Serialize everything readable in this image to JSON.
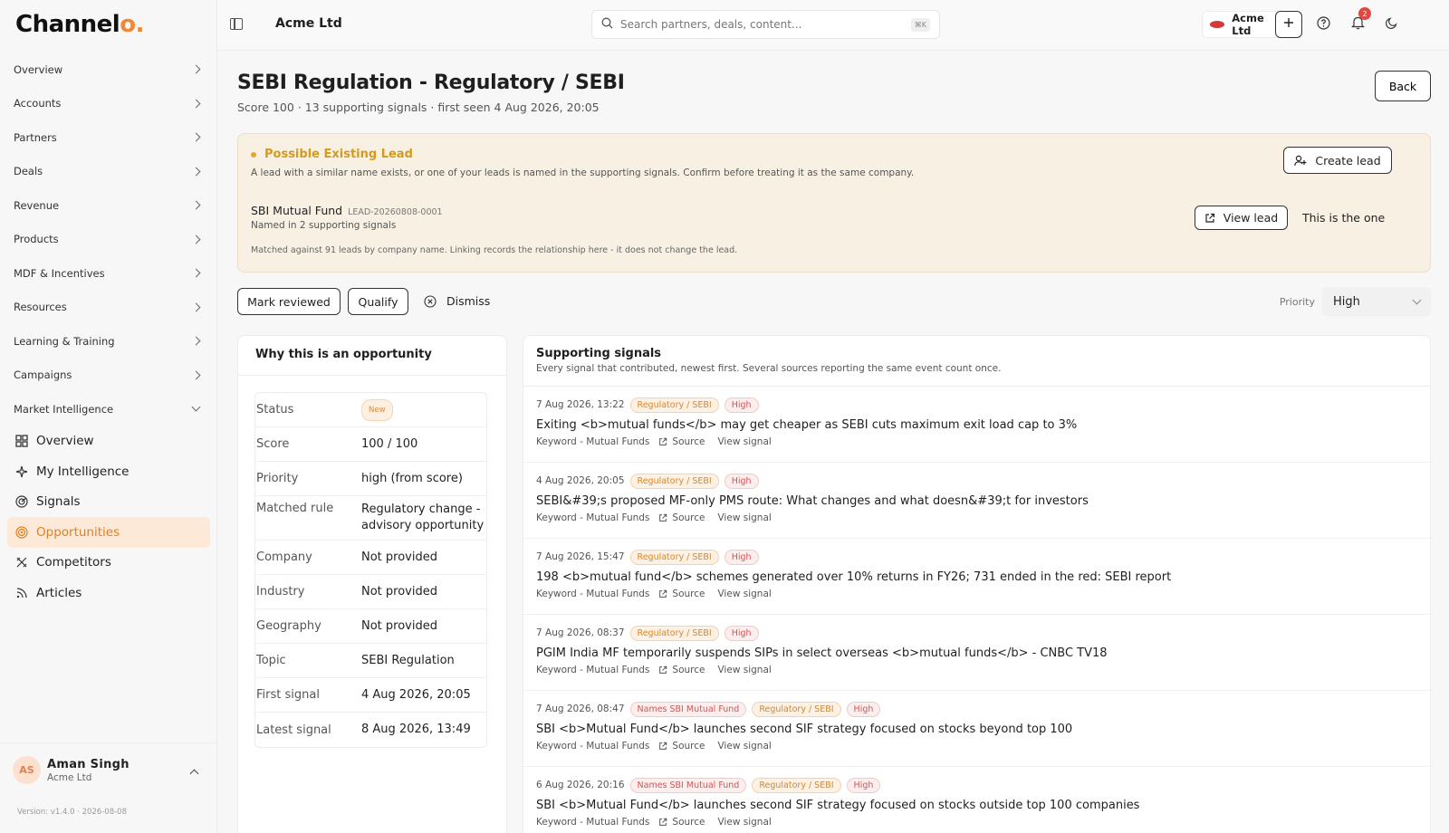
{
  "brand": {
    "name": "Channel",
    "name_tail": "o",
    "dot": "."
  },
  "nav": {
    "items": [
      {
        "label": "Overview"
      },
      {
        "label": "Accounts"
      },
      {
        "label": "Partners"
      },
      {
        "label": "Deals"
      },
      {
        "label": "Revenue"
      },
      {
        "label": "Products"
      },
      {
        "label": "MDF & Incentives"
      },
      {
        "label": "Resources"
      },
      {
        "label": "Learning & Training"
      },
      {
        "label": "Campaigns"
      }
    ],
    "group_label": "Market Intelligence",
    "sub_items": [
      {
        "label": "Overview",
        "icon": "grid-icon"
      },
      {
        "label": "My Intelligence",
        "icon": "sparkle-icon"
      },
      {
        "label": "Signals",
        "icon": "radar-icon"
      },
      {
        "label": "Opportunities",
        "icon": "target-icon",
        "active": true
      },
      {
        "label": "Competitors",
        "icon": "swords-icon"
      },
      {
        "label": "Articles",
        "icon": "rss-icon"
      }
    ]
  },
  "user": {
    "initials": "AS",
    "name": "Aman Singh",
    "org": "Acme Ltd"
  },
  "version": "Version: v1.4.0 · 2026-08-08",
  "topbar": {
    "org_title": "Acme Ltd",
    "search_placeholder": "Search partners, deals, content...",
    "shortcut": "⌘K",
    "org_chip": "Acme Ltd",
    "notifications": "2"
  },
  "page": {
    "title": "SEBI Regulation - Regulatory / SEBI",
    "subtitle": "Score 100 · 13 supporting signals · first seen 4 Aug 2026, 20:05",
    "back": "Back"
  },
  "lead": {
    "heading": "Possible Existing Lead",
    "description": "A lead with a similar name exists, or one of your leads is named in the supporting signals. Confirm before treating it as the same company.",
    "name": "SBI Mutual Fund",
    "id": "LEAD-20260808-0001",
    "named": "Named in 2 supporting signals",
    "match": "Matched against 91 leads by company name. Linking records the relationship here - it does not change the lead.",
    "create": "Create lead",
    "view": "View lead",
    "this_one": "This is the one"
  },
  "actions": {
    "mark_reviewed": "Mark reviewed",
    "qualify": "Qualify",
    "dismiss": "Dismiss",
    "priority_label": "Priority",
    "priority_value": "High"
  },
  "why": {
    "title": "Why this is an opportunity",
    "status_label": "Status",
    "status_value": "New",
    "rows": [
      {
        "k": "Score",
        "v": "100 / 100"
      },
      {
        "k": "Priority",
        "v": "high (from score)"
      },
      {
        "k": "Matched rule",
        "v": "Regulatory change - advisory opportunity"
      },
      {
        "k": "Company",
        "v": "Not provided"
      },
      {
        "k": "Industry",
        "v": "Not provided"
      },
      {
        "k": "Geography",
        "v": "Not provided"
      },
      {
        "k": "Topic",
        "v": "SEBI Regulation"
      },
      {
        "k": "First signal",
        "v": "4 Aug 2026, 20:05"
      },
      {
        "k": "Latest signal",
        "v": "8 Aug 2026, 13:49"
      }
    ]
  },
  "signals": {
    "title": "Supporting signals",
    "description": "Every signal that contributed, newest first. Several sources reporting the same event count once.",
    "source_label": "Source",
    "view_label": "View signal",
    "items": [
      {
        "date": "7 Aug 2026, 13:22",
        "tags": [
          {
            "t": "Regulatory / SEBI",
            "k": "reg"
          },
          {
            "t": "High",
            "k": "high"
          }
        ],
        "headline": "Exiting <b>mutual funds</b> may get cheaper as SEBI cuts maximum exit load cap to 3%",
        "keyword": "Keyword - Mutual Funds"
      },
      {
        "date": "4 Aug 2026, 20:05",
        "tags": [
          {
            "t": "Regulatory / SEBI",
            "k": "reg"
          },
          {
            "t": "High",
            "k": "high"
          }
        ],
        "headline": "SEBI&#39;s proposed MF-only PMS route: What changes and what doesn&#39;t for investors",
        "keyword": "Keyword - Mutual Funds"
      },
      {
        "date": "7 Aug 2026, 15:47",
        "tags": [
          {
            "t": "Regulatory / SEBI",
            "k": "reg"
          },
          {
            "t": "High",
            "k": "high"
          }
        ],
        "headline": "198 <b>mutual fund</b> schemes generated over 10% returns in FY26; 731 ended in the red: SEBI report",
        "keyword": "Keyword - Mutual Funds"
      },
      {
        "date": "7 Aug 2026, 08:37",
        "tags": [
          {
            "t": "Regulatory / SEBI",
            "k": "reg"
          },
          {
            "t": "High",
            "k": "high"
          }
        ],
        "headline": "PGIM India MF temporarily suspends SIPs in select overseas <b>mutual funds</b> - CNBC TV18",
        "keyword": "Keyword - Mutual Funds"
      },
      {
        "date": "7 Aug 2026, 08:47",
        "tags": [
          {
            "t": "Names SBI Mutual Fund",
            "k": "names"
          },
          {
            "t": "Regulatory / SEBI",
            "k": "reg"
          },
          {
            "t": "High",
            "k": "high"
          }
        ],
        "headline": "SBI <b>Mutual Fund</b> launches second SIF strategy focused on stocks beyond top 100",
        "keyword": "Keyword - Mutual Funds"
      },
      {
        "date": "6 Aug 2026, 20:16",
        "tags": [
          {
            "t": "Names SBI Mutual Fund",
            "k": "names"
          },
          {
            "t": "Regulatory / SEBI",
            "k": "reg"
          },
          {
            "t": "High",
            "k": "high"
          }
        ],
        "headline": "SBI <b>Mutual Fund</b> launches second SIF strategy focused on stocks outside top 100 companies",
        "keyword": "Keyword - Mutual Funds"
      }
    ]
  }
}
